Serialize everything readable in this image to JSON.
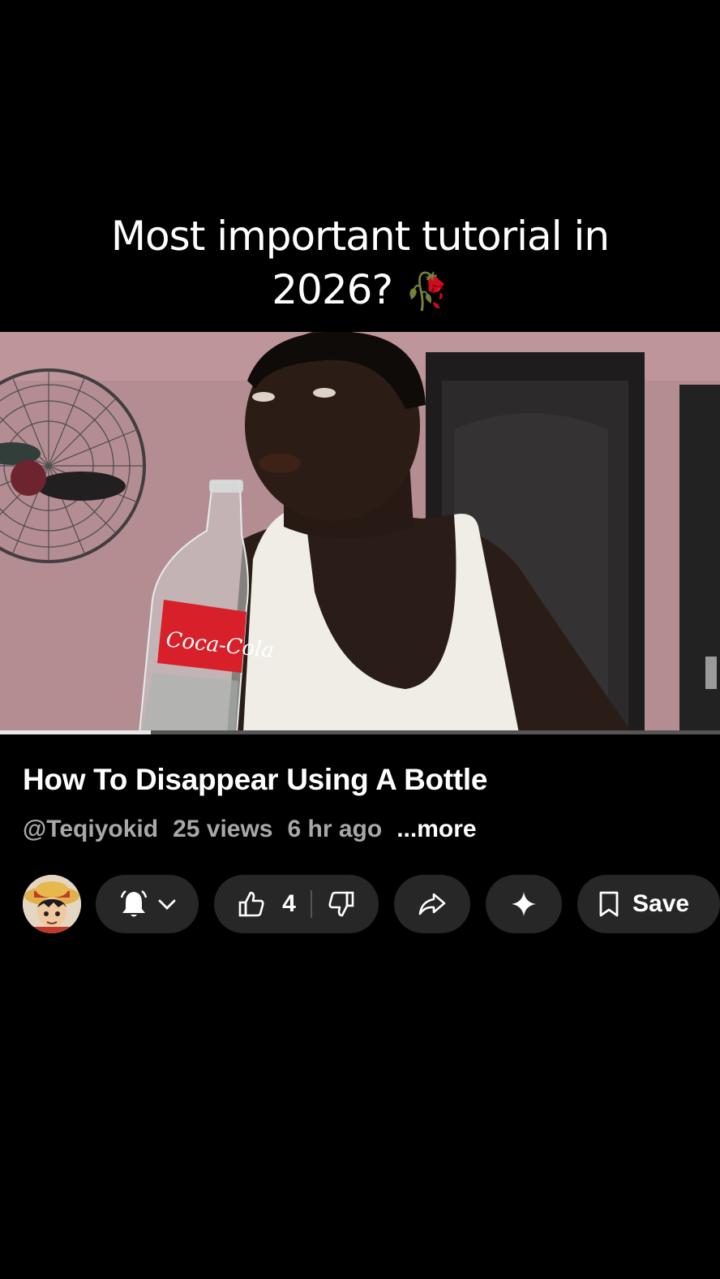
{
  "caption": {
    "line1": "Most important tutorial in",
    "line2": "2026?",
    "emoji": "🥀"
  },
  "video": {
    "progress_fraction": 0.21,
    "bottle_label": "Coca-Cola"
  },
  "title": "How To Disappear Using A Bottle",
  "meta": {
    "channel": "@Teqiyokid",
    "views": "25 views",
    "age": "6 hr ago",
    "more": "...more"
  },
  "actions": {
    "avatar_icon": "channel-avatar",
    "subscribe_icon": "bell-icon",
    "like_count": "4",
    "like_icon": "thumbs-up-icon",
    "dislike_icon": "thumbs-down-icon",
    "share_icon": "share-icon",
    "ask_icon": "sparkle-icon",
    "save_label": "Save",
    "save_icon": "bookmark-icon"
  }
}
